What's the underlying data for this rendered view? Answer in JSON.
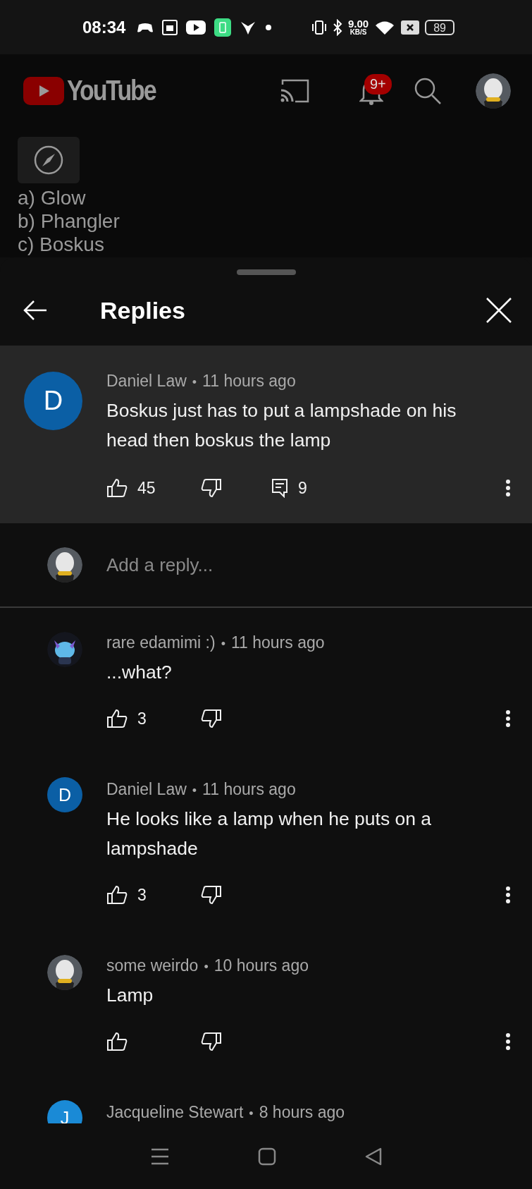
{
  "status_bar": {
    "time": "08:34",
    "net_speed": "9.00",
    "net_unit": "KB/S",
    "battery": "89"
  },
  "app_header": {
    "logo_text": "YouTube",
    "notification_badge": "9+"
  },
  "description_lines": [
    "a) Glow",
    "b) Phangler",
    "c) Boskus"
  ],
  "replies_panel": {
    "title": "Replies",
    "parent_comment": {
      "author": "Daniel Law",
      "separator": "•",
      "time": "11 hours ago",
      "text": "Boskus just has to put a lampshade on his head then boskus the lamp",
      "likes": "45",
      "reply_count": "9",
      "avatar": {
        "kind": "letter",
        "letter": "D",
        "color": "#0b5fa5"
      }
    },
    "reply_field": {
      "placeholder": "Add a reply..."
    },
    "replies": [
      {
        "author": "rare edamimi :)",
        "separator": "•",
        "time": "11 hours ago",
        "text": "...what?",
        "likes": "3"
      },
      {
        "author": "Daniel Law",
        "separator": "•",
        "time": "11 hours ago",
        "text": "He looks like a lamp when he puts on a lampshade",
        "likes": "3",
        "avatar": {
          "kind": "letter",
          "letter": "D",
          "color": "#0b5fa5"
        }
      },
      {
        "author": "some weirdo",
        "separator": "•",
        "time": "10 hours ago",
        "text": "Lamp"
      },
      {
        "author": "Jacqueline Stewart",
        "separator": "•",
        "time": "8 hours ago",
        "avatar": {
          "kind": "letter",
          "letter": "J",
          "color": "#1a8ad6"
        }
      }
    ]
  }
}
